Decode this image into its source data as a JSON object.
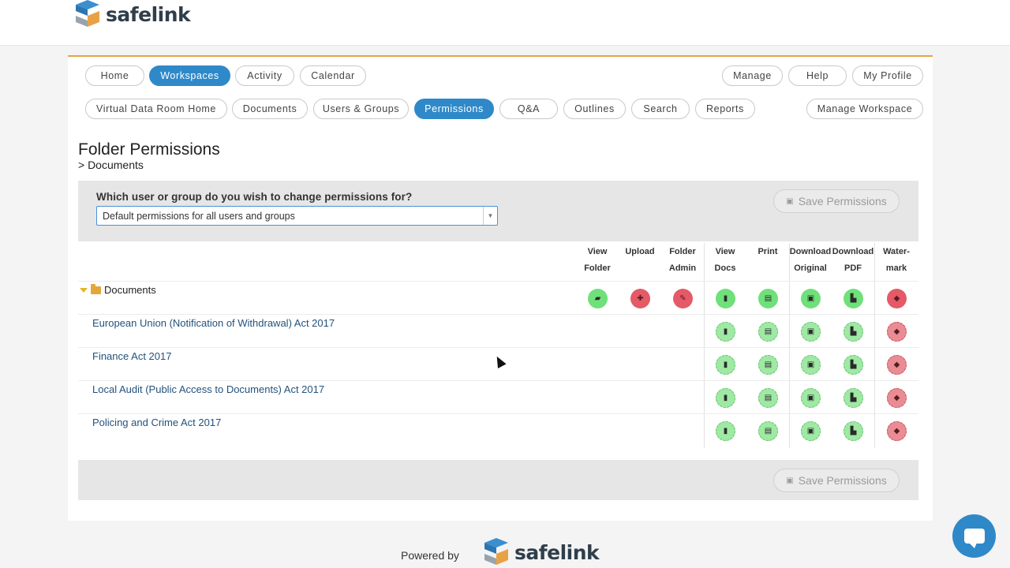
{
  "brand": {
    "name": "safelink",
    "powered_by": "Powered by"
  },
  "main_nav": {
    "left": [
      {
        "label": "Home",
        "active": false
      },
      {
        "label": "Workspaces",
        "active": true
      },
      {
        "label": "Activity",
        "active": false
      },
      {
        "label": "Calendar",
        "active": false
      }
    ],
    "right": [
      {
        "label": "Manage"
      },
      {
        "label": "Help"
      },
      {
        "label": "My Profile"
      }
    ]
  },
  "sub_nav": {
    "left": [
      {
        "label": "Virtual Data Room Home",
        "active": false
      },
      {
        "label": "Documents",
        "active": false
      },
      {
        "label": "Users & Groups",
        "active": false
      },
      {
        "label": "Permissions",
        "active": true
      },
      {
        "label": "Q&A",
        "active": false
      },
      {
        "label": "Outlines",
        "active": false
      },
      {
        "label": "Search",
        "active": false
      },
      {
        "label": "Reports",
        "active": false
      }
    ],
    "right": {
      "label": "Manage Workspace"
    }
  },
  "page": {
    "title": "Folder Permissions",
    "breadcrumb": "> Documents"
  },
  "filter": {
    "label": "Which user or group do you wish to change permissions for?",
    "selected": "Default permissions for all users and groups",
    "save_label": "Save Permissions"
  },
  "columns": [
    {
      "line1": "View",
      "line2": "Folder"
    },
    {
      "line1": "Upload",
      "line2": ""
    },
    {
      "line1": "Folder",
      "line2": "Admin"
    },
    {
      "line1": "View",
      "line2": "Docs"
    },
    {
      "line1": "Print",
      "line2": ""
    },
    {
      "line1": "Download",
      "line2": "Original"
    },
    {
      "line1": "Download",
      "line2": "PDF"
    },
    {
      "line1": "Water-",
      "line2": "mark"
    }
  ],
  "folder": {
    "name": "Documents",
    "permissions": [
      "allowed",
      "denied",
      "denied",
      "allowed",
      "allowed",
      "allowed",
      "allowed",
      "denied"
    ]
  },
  "documents": [
    {
      "name": "European Union (Notification of Withdrawal) Act 2017",
      "permissions": [
        "inherited-allowed",
        "inherited-allowed",
        "inherited-allowed",
        "inherited-allowed",
        "inherited-denied"
      ]
    },
    {
      "name": "Finance Act 2017",
      "permissions": [
        "inherited-allowed",
        "inherited-allowed",
        "inherited-allowed",
        "inherited-allowed",
        "inherited-denied"
      ]
    },
    {
      "name": "Local Audit (Public Access to Documents) Act 2017",
      "permissions": [
        "inherited-allowed",
        "inherited-allowed",
        "inherited-allowed",
        "inherited-allowed",
        "inherited-denied"
      ]
    },
    {
      "name": "Policing and Crime Act 2017",
      "permissions": [
        "inherited-allowed",
        "inherited-allowed",
        "inherited-allowed",
        "inherited-allowed",
        "inherited-denied"
      ]
    }
  ],
  "icons": {
    "view_folder": "folder-open-icon",
    "upload": "plus-icon",
    "folder_admin": "wrench-icon",
    "view_docs": "document-icon",
    "print": "printer-icon",
    "download_original": "floppy-disk-icon",
    "download_pdf": "pdf-icon",
    "watermark": "tag-icon"
  },
  "colors": {
    "accent": "#2f89c9",
    "header_rule": "#e8a245",
    "allowed": "#6fe07a",
    "denied": "#e45a66",
    "link": "#23527c"
  }
}
